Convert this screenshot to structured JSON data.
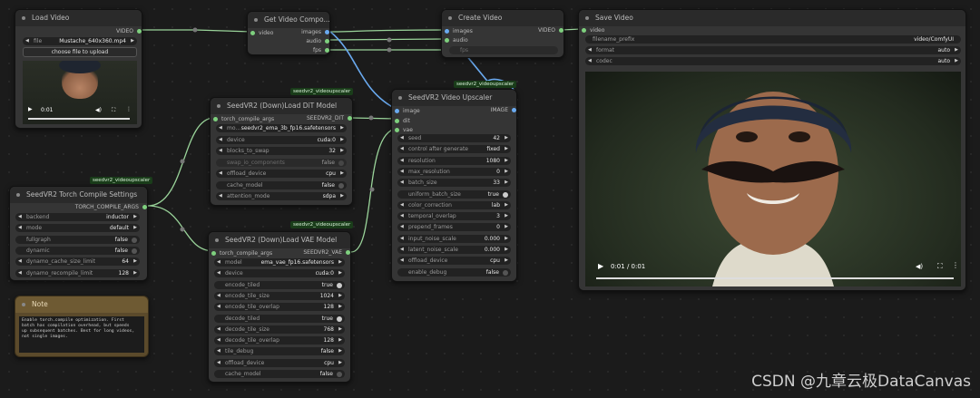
{
  "nodes": {
    "load_video": {
      "title": "Load Video",
      "output": "VIDEO",
      "file_label": "file",
      "file_value": "Mustache_640x360.mp4",
      "upload_btn": "choose file to upload",
      "time": "0:01"
    },
    "get_video_components": {
      "title": "Get Video Compo...",
      "input": "video",
      "outputs": [
        "images",
        "audio",
        "fps"
      ]
    },
    "create_video": {
      "title": "Create Video",
      "inputs": [
        "images",
        "audio"
      ],
      "output": "VIDEO",
      "fps_label": "fps"
    },
    "save_video": {
      "title": "Save Video",
      "input": "video",
      "widgets": [
        {
          "label": "filename_prefix",
          "value": "video/ComfyUI"
        },
        {
          "label": "format",
          "value": "auto"
        },
        {
          "label": "codec",
          "value": "auto"
        }
      ],
      "time": "0:01 / 0:01"
    },
    "load_dit": {
      "tag": "seedvr2_videoupscaler",
      "title": "SeedVR2 (Down)Load DiT Model",
      "input": "torch_compile_args",
      "output": "SEEDVR2_DIT",
      "widgets": [
        {
          "label": "mo...",
          "value": "seedvr2_ema_3b_fp16.safetensors",
          "kind": "combo"
        },
        {
          "label": "device",
          "value": "cuda:0",
          "kind": "combo"
        },
        {
          "label": "blocks_to_swap",
          "value": "32",
          "kind": "combo"
        },
        {
          "label": "swap_io_components",
          "value": "false",
          "kind": "toggle",
          "disabled": true
        },
        {
          "label": "offload_device",
          "value": "cpu",
          "kind": "combo"
        },
        {
          "label": "cache_model",
          "value": "false",
          "kind": "toggle"
        },
        {
          "label": "attention_mode",
          "value": "sdpa",
          "kind": "combo"
        }
      ]
    },
    "load_vae": {
      "tag": "seedvr2_videoupscaler",
      "title": "SeedVR2 (Down)Load VAE Model",
      "input": "torch_compile_args",
      "output": "SEEDVR2_VAE",
      "widgets": [
        {
          "label": "model",
          "value": "ema_vae_fp16.safetensors",
          "kind": "combo"
        },
        {
          "label": "device",
          "value": "cuda:0",
          "kind": "combo"
        },
        {
          "label": "encode_tiled",
          "value": "true",
          "kind": "toggle"
        },
        {
          "label": "encode_tile_size",
          "value": "1024",
          "kind": "combo"
        },
        {
          "label": "encode_tile_overlap",
          "value": "128",
          "kind": "combo"
        },
        {
          "label": "decode_tiled",
          "value": "true",
          "kind": "toggle"
        },
        {
          "label": "decode_tile_size",
          "value": "768",
          "kind": "combo"
        },
        {
          "label": "decode_tile_overlap",
          "value": "128",
          "kind": "combo"
        },
        {
          "label": "tile_debug",
          "value": "false",
          "kind": "combo"
        },
        {
          "label": "offload_device",
          "value": "cpu",
          "kind": "combo"
        },
        {
          "label": "cache_model",
          "value": "false",
          "kind": "toggle"
        }
      ]
    },
    "upscaler": {
      "tag": "seedvr2_videoupscaler",
      "title": "SeedVR2 Video Upscaler",
      "inputs": [
        "image",
        "dit",
        "vae"
      ],
      "output": "IMAGE",
      "widgets": [
        {
          "label": "seed",
          "value": "42",
          "kind": "combo"
        },
        {
          "label": "control after generate",
          "value": "fixed",
          "kind": "combo"
        },
        {
          "label": "resolution",
          "value": "1080",
          "kind": "combo"
        },
        {
          "label": "max_resolution",
          "value": "0",
          "kind": "combo"
        },
        {
          "label": "batch_size",
          "value": "33",
          "kind": "combo"
        },
        {
          "label": "uniform_batch_size",
          "value": "true",
          "kind": "toggle"
        },
        {
          "label": "color_correction",
          "value": "lab",
          "kind": "combo"
        },
        {
          "label": "temporal_overlap",
          "value": "3",
          "kind": "combo"
        },
        {
          "label": "prepend_frames",
          "value": "0",
          "kind": "combo"
        },
        {
          "label": "input_noise_scale",
          "value": "0.000",
          "kind": "combo"
        },
        {
          "label": "latent_noise_scale",
          "value": "0.000",
          "kind": "combo"
        },
        {
          "label": "offload_device",
          "value": "cpu",
          "kind": "combo"
        },
        {
          "label": "enable_debug",
          "value": "false",
          "kind": "toggle"
        }
      ]
    },
    "compile": {
      "tag": "seedvr2_videoupscaler",
      "title": "SeedVR2 Torch Compile Settings",
      "output": "TORCH_COMPILE_ARGS",
      "widgets": [
        {
          "label": "backend",
          "value": "inductor",
          "kind": "combo"
        },
        {
          "label": "mode",
          "value": "default",
          "kind": "combo"
        },
        {
          "label": "fullgraph",
          "value": "false",
          "kind": "toggle"
        },
        {
          "label": "dynamic",
          "value": "false",
          "kind": "toggle"
        },
        {
          "label": "dynamo_cache_size_limit",
          "value": "64",
          "kind": "combo"
        },
        {
          "label": "dynamo_recompile_limit",
          "value": "128",
          "kind": "combo"
        }
      ]
    },
    "note": {
      "title": "Note",
      "text": "Enable torch.compile optimization. First\nbatch has compilation overhead, but speeds\nup subsequent batches. Best for long videos,\nnot single images."
    }
  },
  "watermark": "CSDN @九章云极DataCanvas",
  "colors": {
    "accent_green": "#7ed07e",
    "accent_blue": "#6aaaf0",
    "tag_bg": "#1a3d1a"
  }
}
